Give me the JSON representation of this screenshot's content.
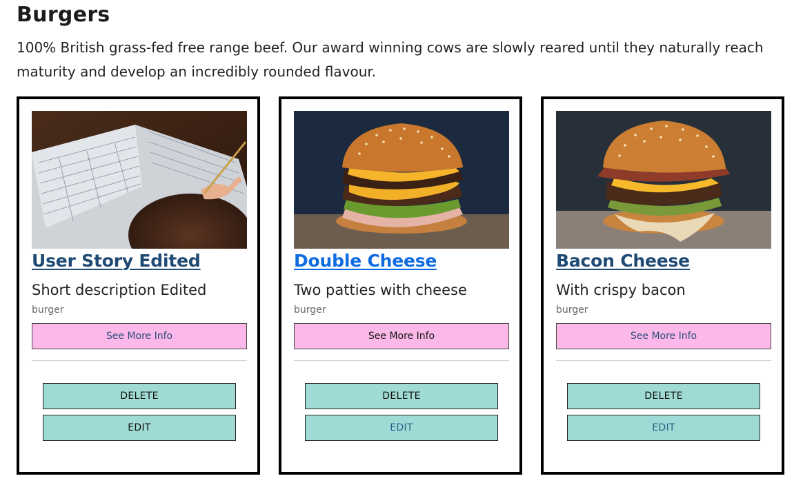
{
  "section": {
    "title": "Burgers",
    "description": "100% British grass-fed free range beef. Our award winning cows are slowly reared until they naturally reach maturity and develop an incredibly rounded flavour."
  },
  "cards": [
    {
      "title": "User Story Edited",
      "short_description": "Short description Edited",
      "category": "burger",
      "info_label": "See More Info",
      "delete_label": "DELETE",
      "edit_label": "EDIT",
      "image": "worksheet-photo"
    },
    {
      "title": "Double Cheese",
      "short_description": "Two patties with cheese",
      "category": "burger",
      "info_label": "See More Info",
      "delete_label": "DELETE",
      "edit_label": "EDIT",
      "image": "double-cheese-burger-photo"
    },
    {
      "title": "Bacon Cheese",
      "short_description": "With crispy bacon",
      "category": "burger",
      "info_label": "See More Info",
      "delete_label": "DELETE",
      "edit_label": "EDIT",
      "image": "bacon-cheese-burger-photo"
    }
  ],
  "colors": {
    "info_button": "#fbb8e9",
    "action_button": "#9fdbd4",
    "title_link": "#1f4a74",
    "title_link_active": "#0f6be0"
  }
}
